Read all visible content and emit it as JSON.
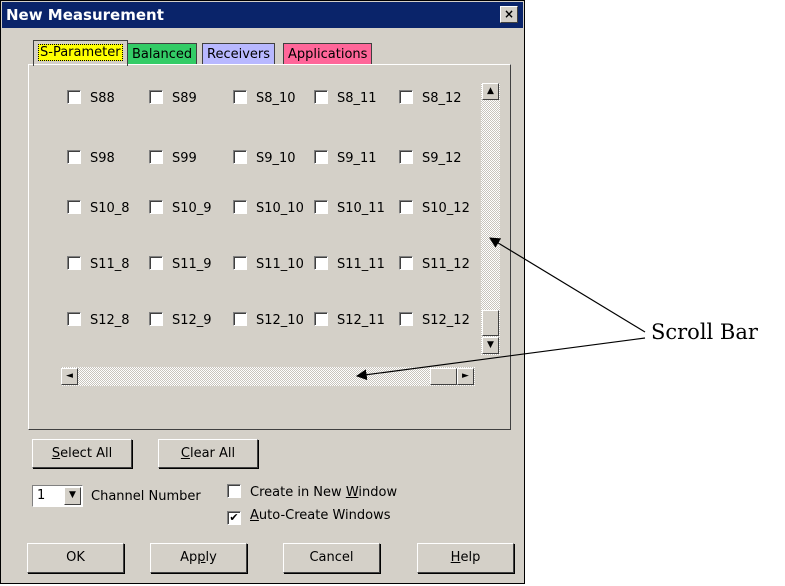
{
  "window": {
    "title": "New Measurement",
    "close_glyph": "×"
  },
  "tabs": [
    {
      "label": "S-Parameter",
      "color": "#ffff00",
      "active": true
    },
    {
      "label": "Balanced",
      "color": "#33cc66",
      "active": false
    },
    {
      "label": "Receivers",
      "color": "#b8b8ff",
      "active": false
    },
    {
      "label": "Applications",
      "color": "#ff6699",
      "active": false
    }
  ],
  "measurements": [
    [
      "S88",
      "S89",
      "S8_10",
      "S8_11",
      "S8_12"
    ],
    [
      "S98",
      "S99",
      "S9_10",
      "S9_11",
      "S9_12"
    ],
    [
      "S10_8",
      "S10_9",
      "S10_10",
      "S10_11",
      "S10_12"
    ],
    [
      "S11_8",
      "S11_9",
      "S11_10",
      "S11_11",
      "S11_12"
    ],
    [
      "S12_8",
      "S12_9",
      "S12_10",
      "S12_11",
      "S12_12"
    ]
  ],
  "scroll_glyphs": {
    "up": "▲",
    "down": "▼",
    "left": "◄",
    "right": "►"
  },
  "buttons": {
    "select_all_u": "S",
    "select_all_rest": "elect All",
    "clear_all_u": "C",
    "clear_all_rest": "lear All",
    "ok": "OK",
    "apply_pre": "Ap",
    "apply_u": "p",
    "apply_post": "ly",
    "cancel": "Cancel",
    "help_u": "H",
    "help_rest": "elp"
  },
  "channel": {
    "value": "1",
    "label": "Channel Number",
    "arrow": "▼"
  },
  "options": {
    "new_window_pre": "Create in New ",
    "new_window_u": "W",
    "new_window_post": "indow",
    "new_window_checked": false,
    "auto_u": "A",
    "auto_rest": "uto-Create Windows",
    "auto_checked": true,
    "check_mark": "✔"
  },
  "annotation": {
    "label": "Scroll Bar"
  }
}
